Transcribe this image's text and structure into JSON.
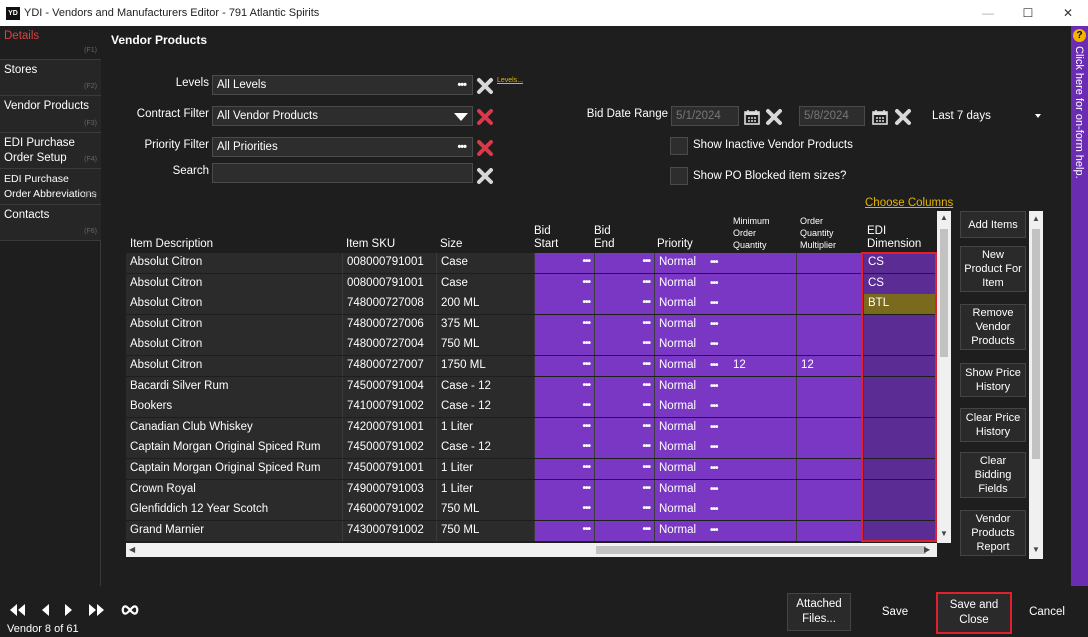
{
  "window": {
    "logo_text": "YD",
    "title": "YDI - Vendors and Manufacturers Editor - 791 Atlantic Spirits"
  },
  "nav": [
    {
      "label": "Details",
      "fkey": "(F1)"
    },
    {
      "label": "Stores",
      "fkey": "(F2)"
    },
    {
      "label": "Vendor Products",
      "fkey": "(F3)"
    },
    {
      "label": "EDI Purchase Order Setup",
      "fkey": "(F4)"
    },
    {
      "label": "EDI Purchase Order Abbreviations",
      "fkey": "(F5)"
    },
    {
      "label": "Contacts",
      "fkey": "(F6)"
    }
  ],
  "section_title": "Vendor Products",
  "filters": {
    "levels_label": "Levels",
    "levels_value": "All Levels",
    "levels_link": "Levels...",
    "contract_label": "Contract Filter",
    "contract_value": "All Vendor Products",
    "priority_label": "Priority Filter",
    "priority_value": "All Priorities",
    "search_label": "Search",
    "search_value": "",
    "bid_range_label": "Bid Date Range",
    "bid_start": "5/1/2024",
    "bid_end": "5/8/2024",
    "range_preset": "Last 7 days",
    "show_inactive_label": "Show Inactive Vendor Products",
    "show_blocked_label": "Show PO Blocked item sizes?",
    "choose_columns": "Choose Columns"
  },
  "columns": {
    "desc": "Item Description",
    "sku": "Item SKU",
    "size": "Size",
    "bid_start": "Bid\nStart",
    "bid_end": "Bid\nEnd",
    "priority": "Priority",
    "min_qty": "Minimum\nOrder\nQuantity",
    "multiplier": "Order\nQuantity\nMultiplier",
    "edi": "EDI\nDimension"
  },
  "rows": [
    {
      "desc": "Absolut Citron",
      "sku": "008000791001",
      "size": "Case",
      "priority": "Normal",
      "min_qty": "",
      "multiplier": "",
      "edi": "CS"
    },
    {
      "desc": "Absolut Citron",
      "sku": "008000791001",
      "size": "Case",
      "priority": "Normal",
      "min_qty": "",
      "multiplier": "",
      "edi": "CS"
    },
    {
      "desc": "Absolut Citron",
      "sku": "748000727008",
      "size": "200 ML",
      "priority": "Normal",
      "min_qty": "",
      "multiplier": "",
      "edi": "BTL"
    },
    {
      "desc": "Absolut Citron",
      "sku": "748000727006",
      "size": "375 ML",
      "priority": "Normal",
      "min_qty": "",
      "multiplier": "",
      "edi": ""
    },
    {
      "desc": "Absolut Citron",
      "sku": "748000727004",
      "size": "750 ML",
      "priority": "Normal",
      "min_qty": "",
      "multiplier": "",
      "edi": ""
    },
    {
      "desc": "Absolut Citron",
      "sku": "748000727007",
      "size": "1750 ML",
      "priority": "Normal",
      "min_qty": "12",
      "multiplier": "12",
      "edi": ""
    },
    {
      "desc": "Bacardi Silver Rum",
      "sku": "745000791004",
      "size": "Case - 12",
      "priority": "Normal",
      "min_qty": "",
      "multiplier": "",
      "edi": ""
    },
    {
      "desc": "Bookers",
      "sku": "741000791002",
      "size": "Case - 12",
      "priority": "Normal",
      "min_qty": "",
      "multiplier": "",
      "edi": ""
    },
    {
      "desc": "Canadian Club Whiskey",
      "sku": "742000791001",
      "size": "1 Liter",
      "priority": "Normal",
      "min_qty": "",
      "multiplier": "",
      "edi": ""
    },
    {
      "desc": "Captain Morgan Original Spiced Rum",
      "sku": "745000791002",
      "size": "Case - 12",
      "priority": "Normal",
      "min_qty": "",
      "multiplier": "",
      "edi": ""
    },
    {
      "desc": "Captain Morgan Original Spiced Rum",
      "sku": "745000791001",
      "size": "1 Liter",
      "priority": "Normal",
      "min_qty": "",
      "multiplier": "",
      "edi": ""
    },
    {
      "desc": "Crown Royal",
      "sku": "749000791003",
      "size": "1 Liter",
      "priority": "Normal",
      "min_qty": "",
      "multiplier": "",
      "edi": ""
    },
    {
      "desc": "Glenfiddich 12 Year Scotch",
      "sku": "746000791002",
      "size": "750 ML",
      "priority": "Normal",
      "min_qty": "",
      "multiplier": "",
      "edi": ""
    },
    {
      "desc": "Grand Marnier",
      "sku": "743000791002",
      "size": "750 ML",
      "priority": "Normal",
      "min_qty": "",
      "multiplier": "",
      "edi": ""
    }
  ],
  "side_buttons": [
    "Add Items",
    "New Product For Item",
    "Remove Vendor Products",
    "Show Price History",
    "Clear Price History",
    "Clear Bidding Fields",
    "Vendor Products Report"
  ],
  "help_text": "Click here for on-form help.",
  "record_info": "Vendor 8 of 61",
  "bottom_buttons": {
    "attached": "Attached Files...",
    "save": "Save",
    "save_close": "Save and Close",
    "cancel": "Cancel"
  },
  "colors": {
    "accent_purple": "#7a37c3",
    "alert_red": "#e0202c",
    "link_gold": "#e8b400"
  }
}
